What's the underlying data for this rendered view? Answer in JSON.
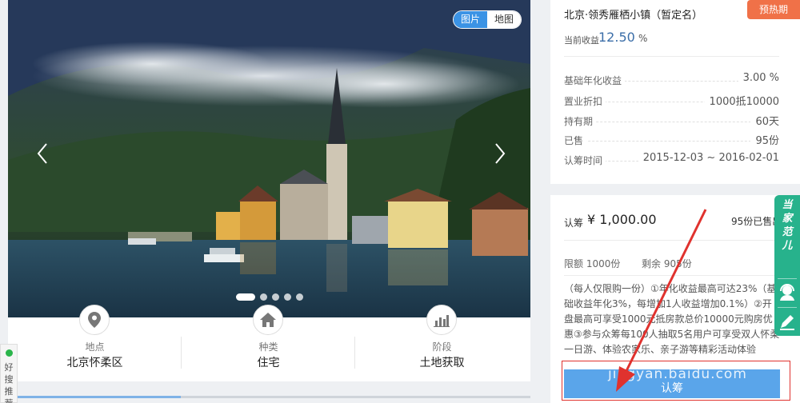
{
  "gallery": {
    "toggle": {
      "photo_label": "图片",
      "map_label": "地图"
    },
    "dot_count": 5,
    "active_dot": 0
  },
  "info": [
    {
      "icon": "location-pin-icon",
      "label": "地点",
      "value": "北京怀柔区"
    },
    {
      "icon": "house-icon",
      "label": "种类",
      "value": "住宅"
    },
    {
      "icon": "bar-chart-icon",
      "label": "阶段",
      "value": "土地获取"
    }
  ],
  "progress": 0.32,
  "project": {
    "title": "北京·领秀雁栖小镇（暂定名）",
    "badge": "预热期",
    "current_return_label": "当前收益",
    "current_return_value": "12.50",
    "current_return_unit": "%",
    "details": [
      {
        "key": "基础年化收益",
        "value": "3.00 %"
      },
      {
        "key": "置业折扣",
        "value": "1000抵10000"
      },
      {
        "key": "持有期",
        "value": "60天"
      },
      {
        "key": "已售",
        "value": "95份"
      },
      {
        "key": "认筹时间",
        "value": "2015-12-03 ~ 2016-02-01"
      }
    ]
  },
  "subscription": {
    "label": "认筹",
    "amount": "¥ 1,000.00",
    "sold": "95份已售出",
    "limit": "限额 1000份",
    "remaining": "剩余 905份",
    "description": "（每人仅限购一份）①年化收益最高可达23%（基础收益年化3%，每增加1人收益增加0.1%）②开盘最高可享受1000元抵房款总价10000元购房优惠③参与众筹每100人抽取5名用户可享受双人怀柔一日游、体验农家乐、亲子游等精彩活动体验",
    "button_label": "认筹"
  },
  "side_widget": {
    "brand": [
      "当",
      "家",
      "范",
      "儿"
    ]
  },
  "hot_widget": {
    "text": "好搜推荐"
  },
  "watermark": "jingyan.baidu.com",
  "colors": {
    "accent": "#5aa5ea",
    "badge": "#f07148",
    "side": "#27b28c",
    "highlight": "#e0322e"
  }
}
